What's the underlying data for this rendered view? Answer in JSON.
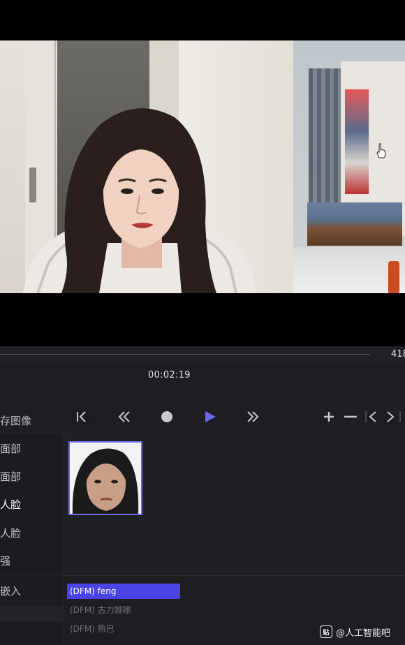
{
  "timeline": {
    "frame_count": "418",
    "timecode": "00:02:19"
  },
  "controls": {
    "save_image_label": "存图像",
    "buttons": [
      {
        "name": "skip-to-start-icon"
      },
      {
        "name": "rewind-icon"
      },
      {
        "name": "stop-icon"
      },
      {
        "name": "play-icon"
      },
      {
        "name": "fast-forward-icon"
      },
      {
        "name": "zoom-in-icon"
      },
      {
        "name": "zoom-out-icon"
      },
      {
        "name": "previous-icon"
      },
      {
        "name": "next-icon"
      }
    ]
  },
  "sidebar": {
    "items": [
      {
        "label": "面部"
      },
      {
        "label": "面部"
      },
      {
        "label": "人脸",
        "active": true
      },
      {
        "label": "人脸"
      },
      {
        "label": "强"
      },
      {
        "label": "嵌入"
      }
    ]
  },
  "models": {
    "items": [
      {
        "label": "(DFM) feng",
        "selected": true
      },
      {
        "label": "(DFM) 古力娜娜"
      },
      {
        "label": "(DFM) 热巴"
      }
    ]
  },
  "watermark": {
    "badge": "贴",
    "text": "@人工智能吧"
  },
  "colors": {
    "accent": "#4a44e4",
    "panel_bg": "#1d1d22",
    "play_icon": "#6a66f0"
  }
}
